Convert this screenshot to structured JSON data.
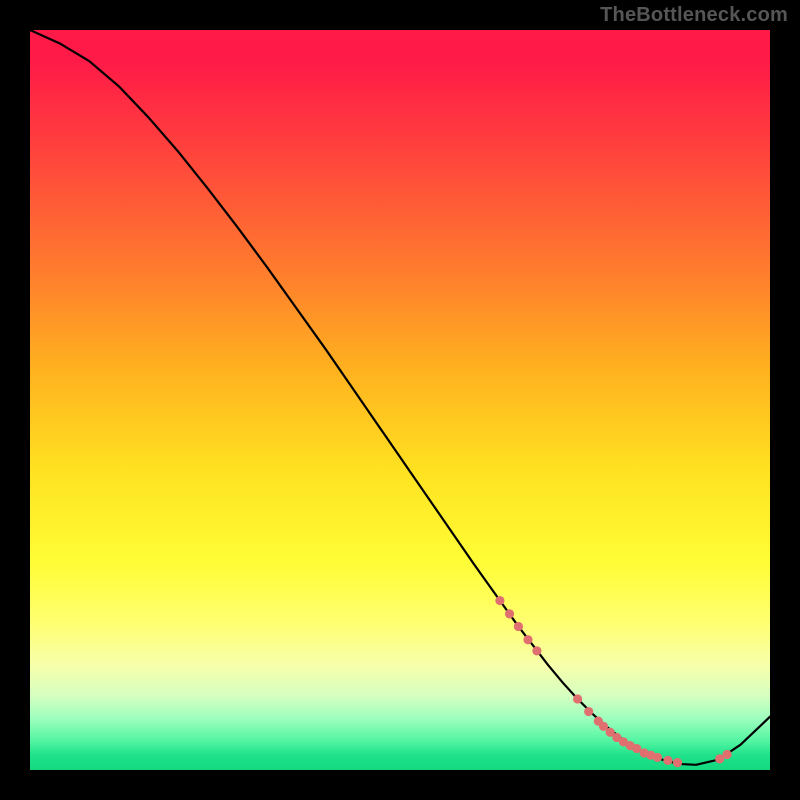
{
  "attribution": "TheBottleneck.com",
  "chart_data": {
    "type": "line",
    "title": "",
    "xlabel": "",
    "ylabel": "",
    "xlim": [
      0,
      100
    ],
    "ylim": [
      0,
      100
    ],
    "grid": false,
    "series": [
      {
        "name": "curve",
        "x": [
          0,
          4,
          8,
          12,
          16,
          20,
          24,
          28,
          32,
          36,
          40,
          44,
          48,
          52,
          56,
          60,
          64,
          66,
          68,
          70,
          72,
          74,
          76,
          78,
          80,
          82,
          84,
          86,
          88,
          90,
          93,
          96,
          100
        ],
        "y": [
          100,
          98.2,
          95.8,
          92.4,
          88.2,
          83.6,
          78.6,
          73.4,
          68.0,
          62.4,
          56.8,
          51.0,
          45.2,
          39.4,
          33.6,
          27.8,
          22.2,
          19.4,
          16.8,
          14.2,
          11.8,
          9.6,
          7.6,
          5.8,
          4.2,
          2.9,
          1.9,
          1.2,
          0.8,
          0.7,
          1.4,
          3.4,
          7.2
        ]
      }
    ],
    "markers": {
      "name": "highlight-points",
      "color": "#e07070",
      "x": [
        63.5,
        64.8,
        66.0,
        67.3,
        68.5,
        74.0,
        75.5,
        76.8,
        77.5,
        78.4,
        79.3,
        80.2,
        81.1,
        82.0,
        83.0,
        83.9,
        84.8,
        86.2,
        87.5,
        93.2,
        94.2
      ],
      "y": [
        22.9,
        21.1,
        19.4,
        17.6,
        16.1,
        9.6,
        7.9,
        6.6,
        5.9,
        5.1,
        4.4,
        3.8,
        3.3,
        2.9,
        2.3,
        2.0,
        1.7,
        1.3,
        1.0,
        1.5,
        2.1
      ]
    },
    "background_gradient": {
      "top": "#ff1a48",
      "bottom": "#13d97f"
    }
  }
}
